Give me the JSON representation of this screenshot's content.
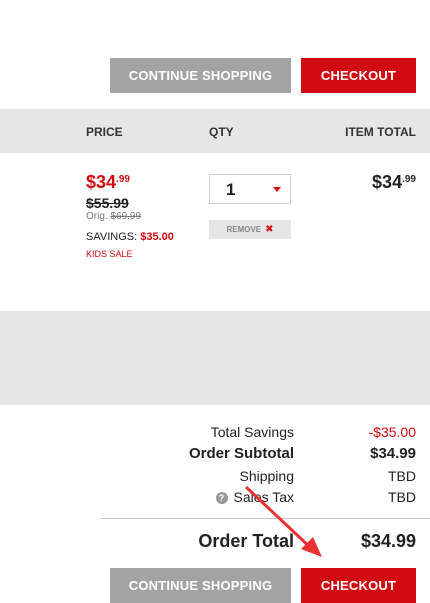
{
  "top_buttons": {
    "continue": "CONTINUE SHOPPING",
    "checkout": "CHECKOUT"
  },
  "table_header": {
    "price": "PRICE",
    "qty": "QTY",
    "item_total": "ITEM TOTAL"
  },
  "item": {
    "price_dollars": "$34",
    "price_cents": ".99",
    "was_price": "$55.99",
    "orig_label": "Orig.",
    "orig_price": "$69.99",
    "savings_label": "SAVINGS:",
    "savings_amount": "$35.00",
    "sale_tag": "KIDS SALE",
    "quantity": "1",
    "remove_label": "REMOVE",
    "remove_x": "✖",
    "total_dollars": "$34",
    "total_cents": ".99"
  },
  "summary": {
    "total_savings_label": "Total Savings",
    "total_savings_value": "-$35.00",
    "order_subtotal_label": "Order Subtotal",
    "order_subtotal_value": "$34.99",
    "shipping_label": "Shipping",
    "shipping_value": "TBD",
    "sales_tax_label": "Sales Tax",
    "sales_tax_value": "TBD",
    "order_total_label": "Order Total",
    "order_total_value": "$34.99"
  },
  "bottom_buttons": {
    "continue": "CONTINUE SHOPPING",
    "checkout": "CHECKOUT"
  },
  "colors": {
    "accent": "#d20a11",
    "button_gray": "#a3a3a3",
    "band_gray": "#e6e6e6"
  },
  "icons": {
    "help": "question-circle-icon",
    "remove": "close-icon",
    "qty_dropdown": "caret-down-icon",
    "annotation": "red-arrow"
  }
}
